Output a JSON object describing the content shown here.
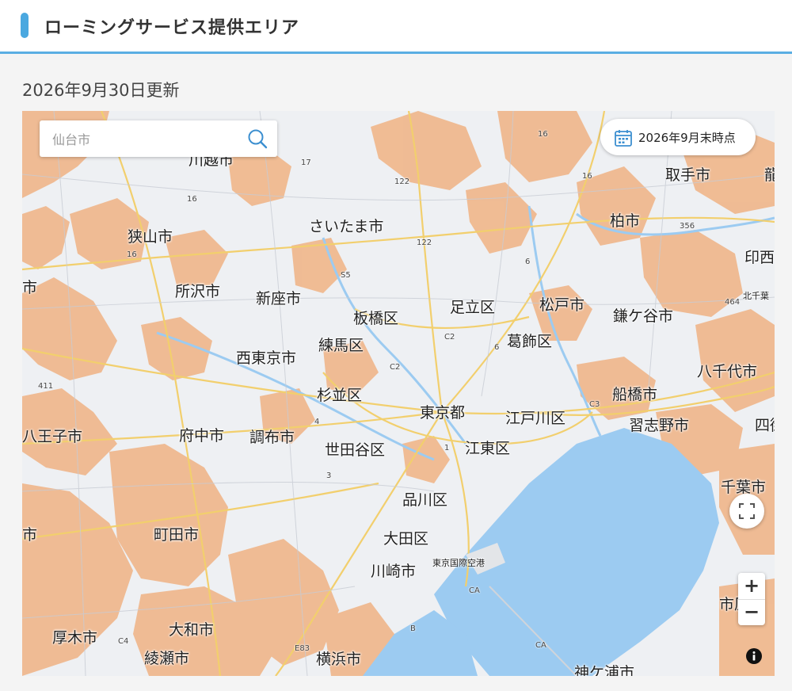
{
  "header": {
    "title": "ローミングサービス提供エリア"
  },
  "updated_text": "2026年9月30日更新",
  "map": {
    "search": {
      "placeholder": "仙台市"
    },
    "date_badge": "2026年9月末時点",
    "icons": {
      "search": "search-icon",
      "calendar": "calendar-icon",
      "fullscreen": "fullscreen-icon",
      "info": "info-icon"
    },
    "zoom_in": "+",
    "zoom_out": "−",
    "colors": {
      "coverage": "#f0b68a",
      "water": "#9ccbf1",
      "land": "#eef0f3",
      "road": "#f2cf6d"
    },
    "labels": {
      "kawagoe": "川越市",
      "saitama": "さいたま市",
      "toride": "取手市",
      "sayama": "狭山市",
      "kashiwa": "柏市",
      "inzai": "印西",
      "tokorozawa": "所沢市",
      "niiza": "新座市",
      "itabashi": "板橋区",
      "adachi": "足立区",
      "matsudo": "松戸市",
      "kamagaya": "鎌ケ谷市",
      "nerima": "練馬区",
      "katsushika": "葛飾区",
      "nishitokyo": "西東京市",
      "yachiyo": "八千代市",
      "suginami": "杉並区",
      "funabashi": "船橋市",
      "tokyo": "東京都",
      "edogawa": "江戸川区",
      "narashino": "習志野市",
      "hachioji": "八王子市",
      "fuchu": "府中市",
      "chofu": "調布市",
      "setagaya": "世田谷区",
      "koto": "江東区",
      "chiba": "千葉市",
      "shinagawa": "品川区",
      "machida": "町田市",
      "ota": "大田区",
      "haneda": "東京国際空港",
      "kawasaki": "川崎市",
      "atsugi": "厚木市",
      "yamato": "大和市",
      "ayase": "綾瀬市",
      "yokohama": "横浜市",
      "kisarazu": "神ケ浦市",
      "shi_left1": "市",
      "shi_left2": "市",
      "shi_right": "市原",
      "yotsukaido": "四街",
      "ryu": "龍",
      "kitachiba": "北千葉"
    },
    "roads": {
      "r16a": "16",
      "r16b": "16",
      "r16c": "16",
      "r16d": "16",
      "r17": "17",
      "r122a": "122",
      "r122b": "122",
      "r356": "356",
      "r464": "464",
      "r6a": "6",
      "r6b": "6",
      "r411": "411",
      "r5": "S5",
      "c2a": "C2",
      "c2b": "C2",
      "c3": "C3",
      "r4": "4",
      "r3": "3",
      "r1": "1",
      "ca1": "CA",
      "ca2": "CA",
      "b": "B",
      "e83": "E83",
      "c4": "C4"
    }
  }
}
